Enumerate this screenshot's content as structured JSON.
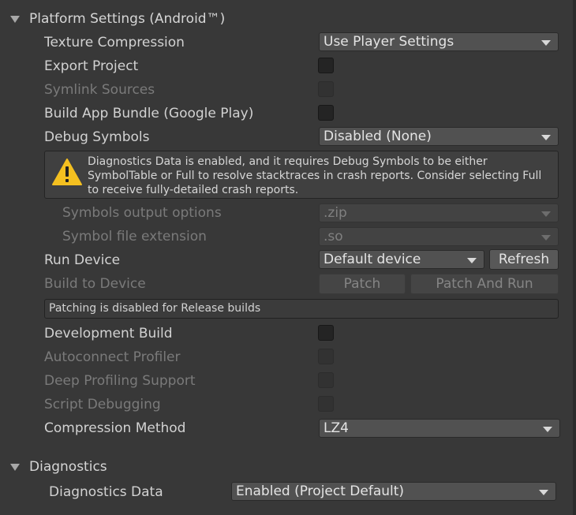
{
  "platform_settings": {
    "title": "Platform Settings (Android™)",
    "texture_compression": {
      "label": "Texture Compression",
      "value": "Use Player Settings"
    },
    "export_project": {
      "label": "Export Project"
    },
    "symlink_sources": {
      "label": "Symlink Sources"
    },
    "build_app_bundle": {
      "label": "Build App Bundle (Google Play)"
    },
    "debug_symbols": {
      "label": "Debug Symbols",
      "value": "Disabled (None)"
    },
    "warning_text": "Diagnostics Data is enabled, and it requires Debug Symbols to be either SymbolTable or Full to resolve stacktraces in crash reports. Consider selecting Full to receive fully-detailed crash reports.",
    "symbols_output": {
      "label": "Symbols output options",
      "value": ".zip"
    },
    "symbol_extension": {
      "label": "Symbol file extension",
      "value": ".so"
    },
    "run_device": {
      "label": "Run Device",
      "value": "Default device",
      "refresh_label": "Refresh"
    },
    "build_to_device": {
      "label": "Build to Device",
      "patch_label": "Patch",
      "patch_and_run_label": "Patch And Run"
    },
    "patching_info": "Patching is disabled for Release builds",
    "development_build": {
      "label": "Development Build"
    },
    "autoconnect_profiler": {
      "label": "Autoconnect Profiler"
    },
    "deep_profiling": {
      "label": "Deep Profiling Support"
    },
    "script_debugging": {
      "label": "Script Debugging"
    },
    "compression_method": {
      "label": "Compression Method",
      "value": "LZ4"
    }
  },
  "diagnostics": {
    "title": "Diagnostics",
    "diagnostics_data": {
      "label": "Diagnostics Data",
      "value": "Enabled (Project Default)"
    }
  },
  "icons": {
    "foldout": "triangle-down-icon",
    "warning": "warning-triangle-icon",
    "dropdown": "chevron-down-icon"
  },
  "colors": {
    "background": "#383838",
    "warning_yellow": "#f4c020"
  }
}
